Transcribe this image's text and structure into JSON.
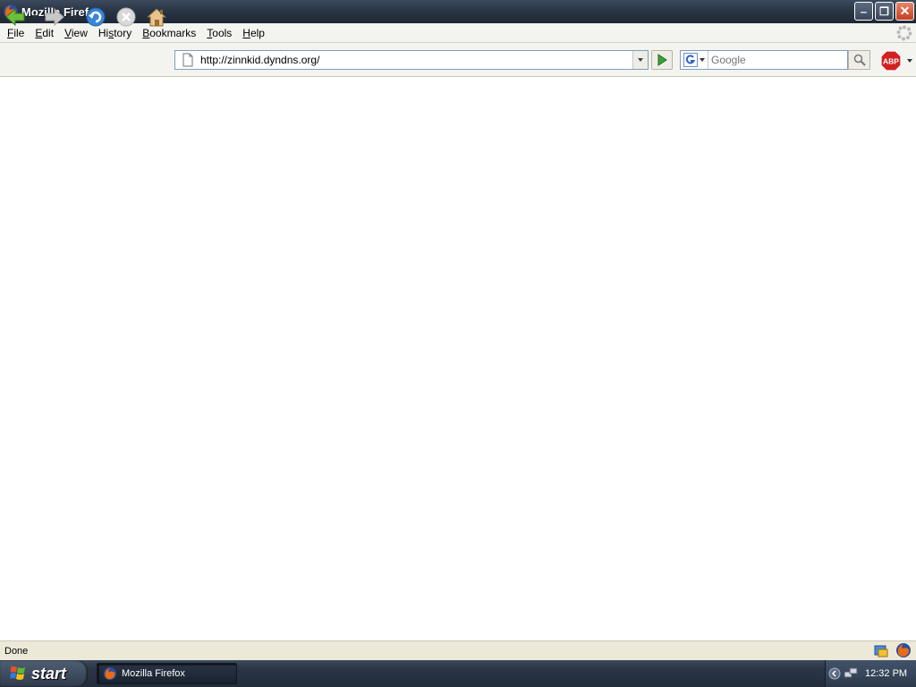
{
  "window": {
    "title": "Mozilla Firefox"
  },
  "menubar": {
    "items": [
      {
        "label": "File",
        "access": "F"
      },
      {
        "label": "Edit",
        "access": "E"
      },
      {
        "label": "View",
        "access": "V"
      },
      {
        "label": "History",
        "access": "s"
      },
      {
        "label": "Bookmarks",
        "access": "B"
      },
      {
        "label": "Tools",
        "access": "T"
      },
      {
        "label": "Help",
        "access": "H"
      }
    ]
  },
  "navigation": {
    "url": "http://zinnkid.dyndns.org/",
    "icons": [
      "back-icon",
      "forward-icon",
      "reload-icon",
      "stop-icon",
      "home-icon"
    ]
  },
  "search": {
    "placeholder": "Google",
    "engine_icon": "google-icon"
  },
  "statusbar": {
    "text": "Done"
  },
  "taskbar": {
    "start_label": "start",
    "task_label": "Mozilla Firefox",
    "clock": "12:32 PM"
  },
  "colors": {
    "titlebar": "#2a3646",
    "chrome": "#f3f3f0",
    "statusbar": "#ece9d8",
    "url_border": "#7f9db9",
    "close_button": "#c4401f",
    "abp_red": "#d32020"
  }
}
